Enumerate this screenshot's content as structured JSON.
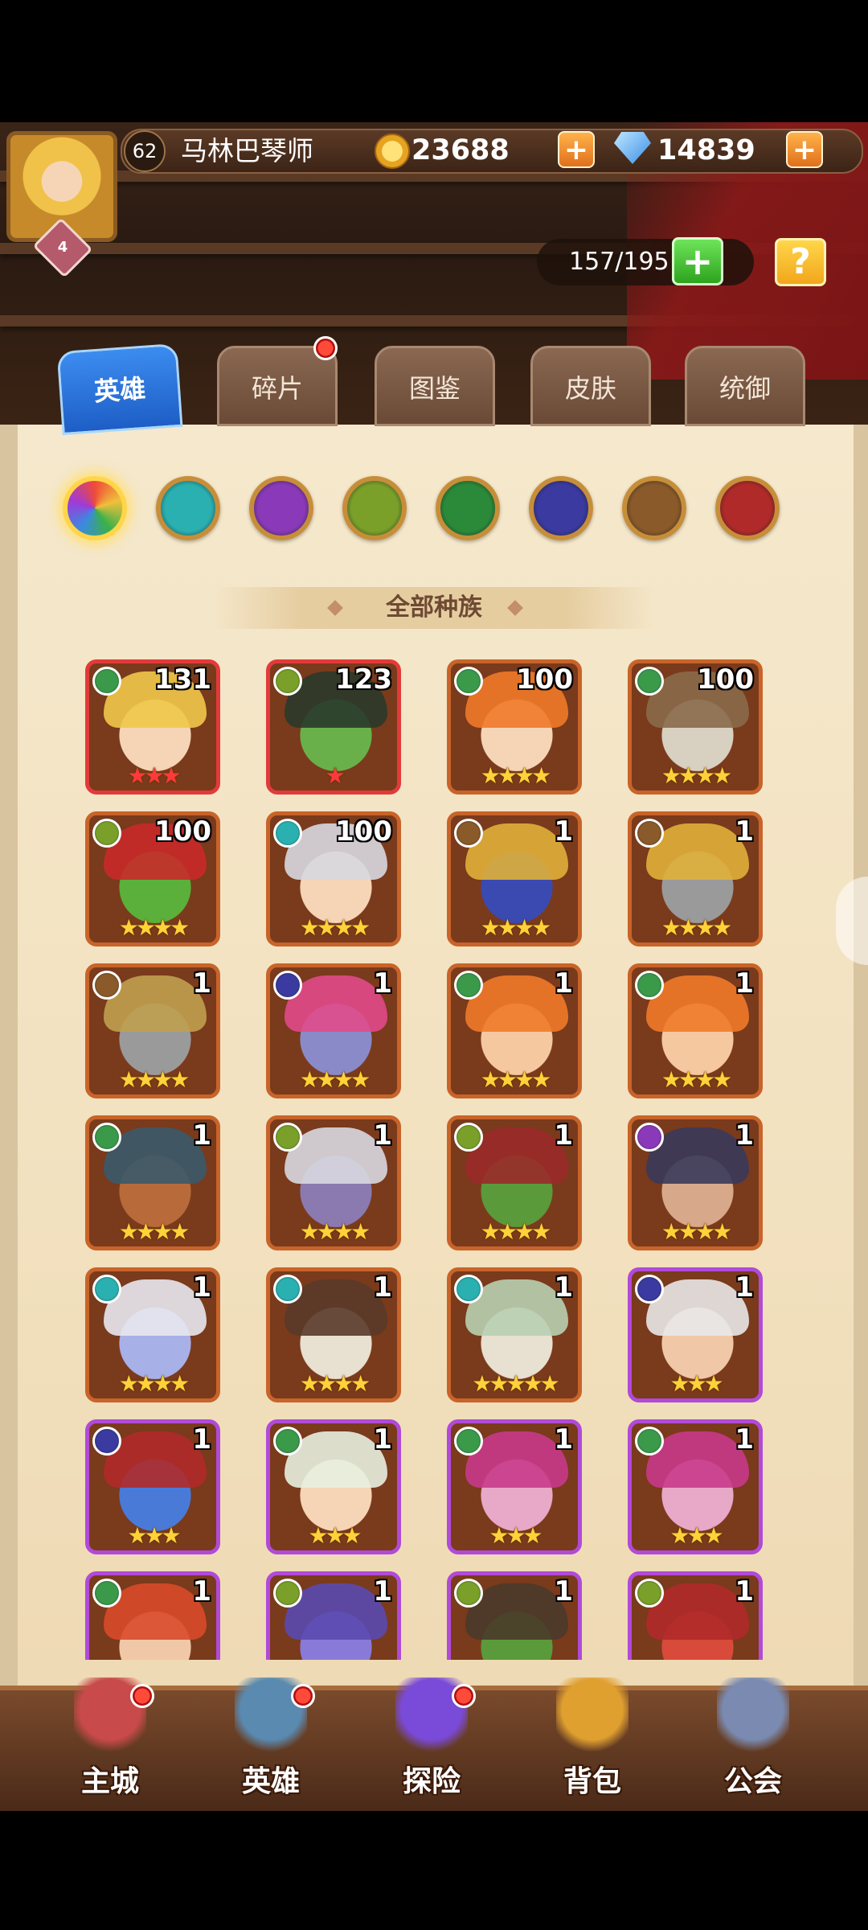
{
  "player": {
    "level": "62",
    "name": "马林巴琴师",
    "vip_level": "4"
  },
  "currency": {
    "gold": "23688",
    "gems": "14839",
    "plus_label": "+"
  },
  "capacity": {
    "value": "157/195",
    "plus_label": "+",
    "help_label": "?"
  },
  "tabs": [
    {
      "label": "英雄",
      "active": true
    },
    {
      "label": "碎片",
      "active": false,
      "badge": true
    },
    {
      "label": "图鉴",
      "active": false
    },
    {
      "label": "皮肤",
      "active": false
    },
    {
      "label": "统御",
      "active": false
    }
  ],
  "race_filters": [
    {
      "icon": "all-races-icon",
      "color": "#f06a3a",
      "selected": true
    },
    {
      "icon": "water-race-icon",
      "color": "#2ab0b0"
    },
    {
      "icon": "shadow-race-icon",
      "color": "#8a3ab8"
    },
    {
      "icon": "earth-race-icon",
      "color": "#7aa02a"
    },
    {
      "icon": "forest-race-icon",
      "color": "#2a8a3a"
    },
    {
      "icon": "dark-race-icon",
      "color": "#3a3aa0"
    },
    {
      "icon": "light-race-icon",
      "color": "#8a5a2a"
    },
    {
      "icon": "fire-race-icon",
      "color": "#b02a2a"
    }
  ],
  "section_title": "全部种族",
  "heroes": [
    {
      "level": "131",
      "stars": "★★★",
      "star_color": "red",
      "frame": "red",
      "element": "#3a9a4a",
      "skin": "#f6d5b7",
      "hair": "#f0c84a"
    },
    {
      "level": "123",
      "stars": "★",
      "star_color": "red",
      "frame": "red",
      "element": "#7aa02a",
      "skin": "#6ab04a",
      "hair": "#2a3a2a"
    },
    {
      "level": "100",
      "stars": "★★★★",
      "star_color": "gold",
      "frame": "orange",
      "element": "#3a9a4a",
      "skin": "#f6d5b7",
      "hair": "#f07a2a"
    },
    {
      "level": "100",
      "stars": "★★★★",
      "star_color": "gold",
      "frame": "orange",
      "element": "#3a9a4a",
      "skin": "#d8d0c0",
      "hair": "#8a6a4a"
    },
    {
      "level": "100",
      "stars": "★★★★",
      "star_color": "gold",
      "frame": "orange",
      "element": "#7aa02a",
      "skin": "#5ab03a",
      "hair": "#c82a2a"
    },
    {
      "level": "100",
      "stars": "★★★★",
      "star_color": "gold",
      "frame": "orange",
      "element": "#2ab0b0",
      "skin": "#f6d5b7",
      "hair": "#d8d8e0"
    },
    {
      "level": "1",
      "stars": "★★★★",
      "star_color": "gold",
      "frame": "orange",
      "element": "#8a5a2a",
      "skin": "#3a4ab0",
      "hair": "#e0b03a"
    },
    {
      "level": "1",
      "stars": "★★★★",
      "star_color": "gold",
      "frame": "orange",
      "element": "#8a5a2a",
      "skin": "#9a9a9a",
      "hair": "#e0b03a"
    },
    {
      "level": "1",
      "stars": "★★★★",
      "star_color": "gold",
      "frame": "orange",
      "element": "#8a5a2a",
      "skin": "#9a9a9a",
      "hair": "#c0a050"
    },
    {
      "level": "1",
      "stars": "★★★★",
      "star_color": "gold",
      "frame": "orange",
      "element": "#3a3aa0",
      "skin": "#8a8ac8",
      "hair": "#e04a8a"
    },
    {
      "level": "1",
      "stars": "★★★★",
      "star_color": "gold",
      "frame": "orange",
      "element": "#3a9a4a",
      "skin": "#f6c8a0",
      "hair": "#f07a2a"
    },
    {
      "level": "1",
      "stars": "★★★★",
      "star_color": "gold",
      "frame": "orange",
      "element": "#3a9a4a",
      "skin": "#f6c8a0",
      "hair": "#f07a2a"
    },
    {
      "level": "1",
      "stars": "★★★★",
      "star_color": "gold",
      "frame": "orange",
      "element": "#3a9a4a",
      "skin": "#b86a3a",
      "hair": "#3a5a6a"
    },
    {
      "level": "1",
      "stars": "★★★★",
      "star_color": "gold",
      "frame": "orange",
      "element": "#7aa02a",
      "skin": "#8a7ab0",
      "hair": "#d8d8e0"
    },
    {
      "level": "1",
      "stars": "★★★★",
      "star_color": "gold",
      "frame": "orange",
      "element": "#7aa02a",
      "skin": "#5a9a3a",
      "hair": "#9a2a2a"
    },
    {
      "level": "1",
      "stars": "★★★★",
      "star_color": "gold",
      "frame": "orange",
      "element": "#8a3ab8",
      "skin": "#d8a88a",
      "hair": "#3a3a5a"
    },
    {
      "level": "1",
      "stars": "★★★★",
      "star_color": "gold",
      "frame": "orange",
      "element": "#2ab0b0",
      "skin": "#a8b0e8",
      "hair": "#e8e8f0"
    },
    {
      "level": "1",
      "stars": "★★★★",
      "star_color": "gold",
      "frame": "orange",
      "element": "#2ab0b0",
      "skin": "#e8e0d0",
      "hair": "#5a3a2a"
    },
    {
      "level": "1",
      "stars": "★★★★★",
      "star_color": "gold",
      "frame": "orange",
      "element": "#2ab0b0",
      "skin": "#e8e0d0",
      "hair": "#b8d0b0"
    },
    {
      "level": "1",
      "stars": "★★★",
      "star_color": "gold",
      "frame": "purple",
      "element": "#3a3aa0",
      "skin": "#f0c8a8",
      "hair": "#e8e8e8"
    },
    {
      "level": "1",
      "stars": "★★★",
      "star_color": "gold",
      "frame": "purple",
      "element": "#3a3aa0",
      "skin": "#4a7ad8",
      "hair": "#b02a2a"
    },
    {
      "level": "1",
      "stars": "★★★",
      "star_color": "gold",
      "frame": "purple",
      "element": "#3a9a4a",
      "skin": "#f6d5b7",
      "hair": "#e8f0e0"
    },
    {
      "level": "1",
      "stars": "★★★",
      "star_color": "gold",
      "frame": "purple",
      "element": "#3a9a4a",
      "skin": "#e8a8c8",
      "hair": "#c83a8a"
    },
    {
      "level": "1",
      "stars": "★★★",
      "star_color": "gold",
      "frame": "purple",
      "element": "#3a9a4a",
      "skin": "#e8a8c8",
      "hair": "#c83a8a"
    },
    {
      "level": "1",
      "stars": "",
      "star_color": "gold",
      "frame": "purple",
      "element": "#3a9a4a",
      "skin": "#f0c8a8",
      "hair": "#d84a2a"
    },
    {
      "level": "1",
      "stars": "",
      "star_color": "gold",
      "frame": "purple",
      "element": "#7aa02a",
      "skin": "#8a7ad8",
      "hair": "#5a4ab0"
    },
    {
      "level": "1",
      "stars": "",
      "star_color": "gold",
      "frame": "purple",
      "element": "#7aa02a",
      "skin": "#5a9a3a",
      "hair": "#4a3a2a"
    },
    {
      "level": "1",
      "stars": "",
      "star_color": "gold",
      "frame": "purple",
      "element": "#7aa02a",
      "skin": "#d84a3a",
      "hair": "#b02a2a"
    }
  ],
  "bottom_nav": [
    {
      "label": "主城",
      "icon": "castle-icon",
      "badge": true,
      "color": "#c84a4a"
    },
    {
      "label": "英雄",
      "icon": "hero-icon",
      "badge": true,
      "color": "#5a8ab0"
    },
    {
      "label": "探险",
      "icon": "portal-icon",
      "badge": true,
      "color": "#7a4ad8"
    },
    {
      "label": "背包",
      "icon": "backpack-icon",
      "badge": false,
      "color": "#e0a030"
    },
    {
      "label": "公会",
      "icon": "guild-icon",
      "badge": false,
      "color": "#7a8ab0"
    }
  ]
}
